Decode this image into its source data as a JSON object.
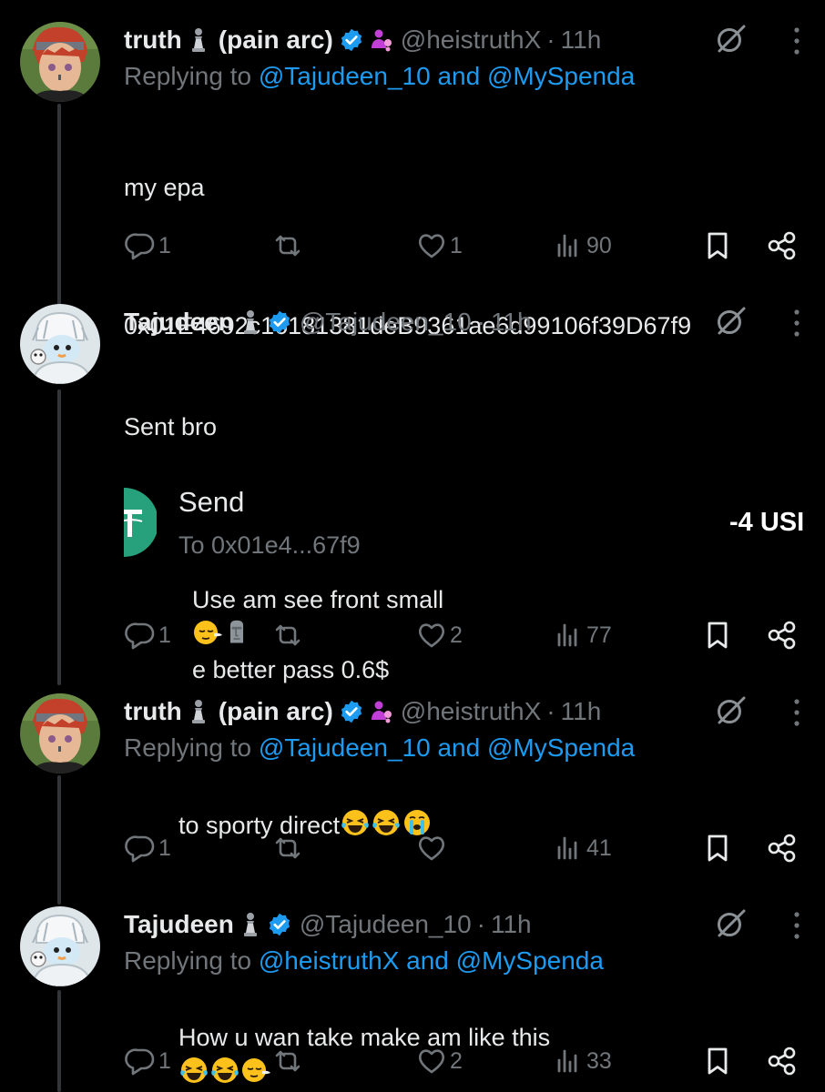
{
  "tweets": [
    {
      "name": "truth",
      "name_suffix": "(pain arc)",
      "handle": "@heistruthX",
      "time": "11h",
      "replying_prefix": "Replying to",
      "replying_1": "@Tajudeen_10",
      "replying_and": "and",
      "replying_2": "@MySpenda",
      "text_line1": "my epa",
      "text_line2": "0x01E4692c16181381deB9361ae6d99106f39D67f9",
      "replies": "1",
      "reposts": "",
      "likes": "1",
      "views": "90"
    },
    {
      "name": "Tajudeen",
      "handle": "@Tajudeen_10",
      "time": "11h",
      "text_line1": "Sent bro",
      "text_line2_a": "Use am see front small",
      "text_line2_b": "e better pass 0.6$",
      "card_title": "Send",
      "card_sub": "To 0x01e4...67f9",
      "card_amount": "-4 USI",
      "replies": "1",
      "reposts": "",
      "likes": "2",
      "views": "77"
    },
    {
      "name": "truth",
      "name_suffix": "(pain arc)",
      "handle": "@heistruthX",
      "time": "11h",
      "replying_prefix": "Replying to",
      "replying_1": "@Tajudeen_10",
      "replying_and": "and",
      "replying_2": "@MySpenda",
      "text_line1": "to sporty direct",
      "replies": "1",
      "reposts": "",
      "likes": "",
      "views": "41"
    },
    {
      "name": "Tajudeen",
      "handle": "@Tajudeen_10",
      "time": "11h",
      "replying_prefix": "Replying to",
      "replying_1": "@heistruthX",
      "replying_and": "and",
      "replying_2": "@MySpenda",
      "text_line1": "How u wan take make am like this",
      "replies": "1",
      "reposts": "",
      "likes": "2",
      "views": "33"
    }
  ],
  "separator": "·",
  "colors": {
    "background": "#000000",
    "text": "#e7e9ea",
    "muted": "#71767b",
    "link": "#1d9bf0",
    "verified": "#1d9bf0",
    "thread_line": "#333639",
    "tether_green": "#26a17b"
  },
  "icons": [
    "pawn-icon",
    "verified-badge-icon",
    "affiliate-icon",
    "grok-icon",
    "more-icon",
    "reply-icon",
    "repost-icon",
    "like-icon",
    "views-icon",
    "bookmark-icon",
    "share-icon",
    "tether-icon"
  ]
}
